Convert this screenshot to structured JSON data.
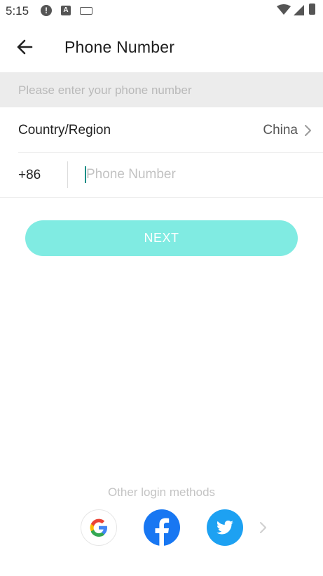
{
  "status_bar": {
    "time": "5:15",
    "icons": [
      "alert-icon",
      "a-icon",
      "keyboard-icon",
      "wifi-icon",
      "signal-icon",
      "battery-icon"
    ]
  },
  "header": {
    "title": "Phone Number",
    "back_icon": "arrow-left-icon"
  },
  "hint": "Please enter your phone number",
  "country": {
    "label": "Country/Region",
    "value": "China",
    "icon": "chevron-right-icon"
  },
  "phone": {
    "code": "+86",
    "placeholder": "Phone Number",
    "value": ""
  },
  "next_button": {
    "label": "NEXT"
  },
  "other_login": {
    "title": "Other login methods",
    "methods": [
      "google-icon",
      "facebook-icon",
      "twitter-icon"
    ],
    "more_icon": "chevron-right-icon"
  },
  "colors": {
    "accent": "#80ebe2",
    "caret": "#1a8e87",
    "hint_bg": "#ececec",
    "facebook": "#1877f2",
    "twitter": "#1da1f2"
  }
}
